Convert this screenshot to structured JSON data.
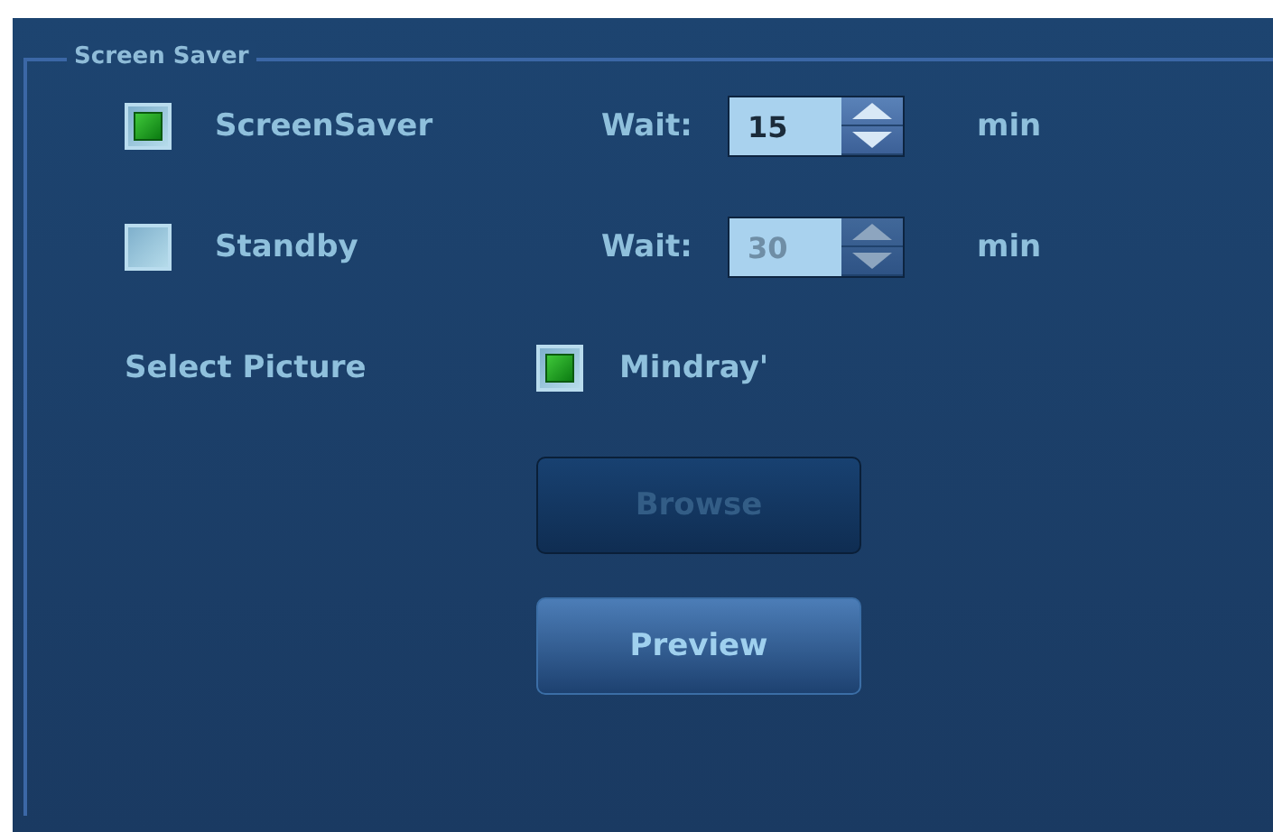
{
  "group": {
    "title": "Screen Saver"
  },
  "options": [
    {
      "label": "ScreenSaver",
      "checked": true,
      "wait_label": "Wait:",
      "value": "15",
      "disabled": false,
      "unit": "min"
    },
    {
      "label": "Standby",
      "checked": false,
      "wait_label": "Wait:",
      "value": "30",
      "disabled": true,
      "unit": "min"
    }
  ],
  "picture": {
    "label": "Select Picture",
    "option": {
      "label": "Mindray'",
      "checked": true
    }
  },
  "buttons": [
    {
      "label": "Browse",
      "disabled": true
    },
    {
      "label": "Preview",
      "disabled": false
    }
  ]
}
